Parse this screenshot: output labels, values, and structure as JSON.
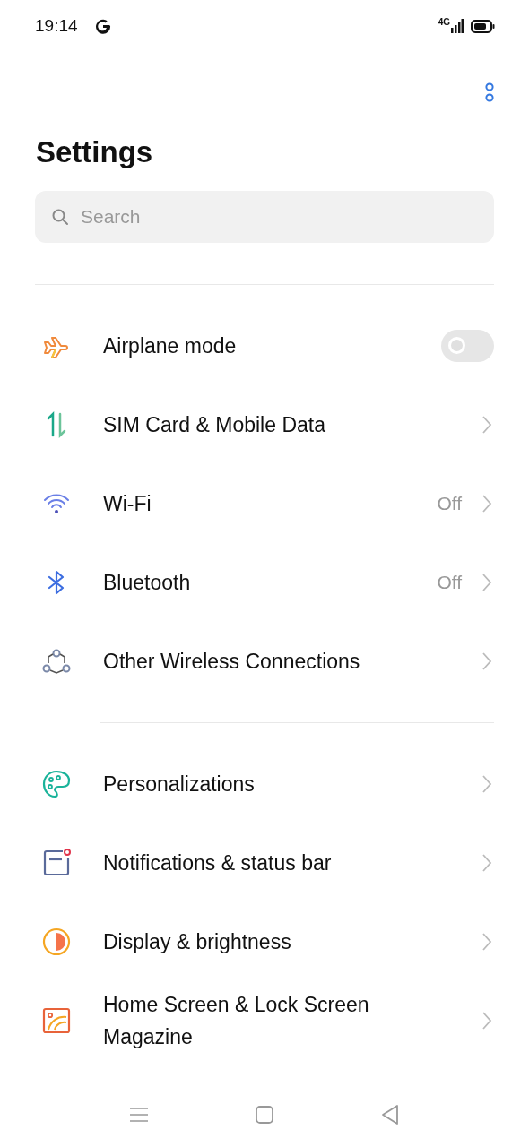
{
  "status_bar": {
    "time": "19:14",
    "network": "4G"
  },
  "title": "Settings",
  "search": {
    "placeholder": "Search"
  },
  "groups": [
    {
      "items": [
        {
          "kind": "toggle",
          "label": "Airplane mode",
          "on": false
        },
        {
          "kind": "link",
          "label": "SIM Card & Mobile Data"
        },
        {
          "kind": "link",
          "label": "Wi-Fi",
          "value": "Off"
        },
        {
          "kind": "link",
          "label": "Bluetooth",
          "value": "Off"
        },
        {
          "kind": "link",
          "label": "Other Wireless Connections"
        }
      ]
    },
    {
      "items": [
        {
          "kind": "link",
          "label": "Personalizations"
        },
        {
          "kind": "link",
          "label": "Notifications & status bar"
        },
        {
          "kind": "link",
          "label": "Display & brightness"
        },
        {
          "kind": "link",
          "label": "Home Screen & Lock Screen Magazine"
        }
      ]
    }
  ]
}
